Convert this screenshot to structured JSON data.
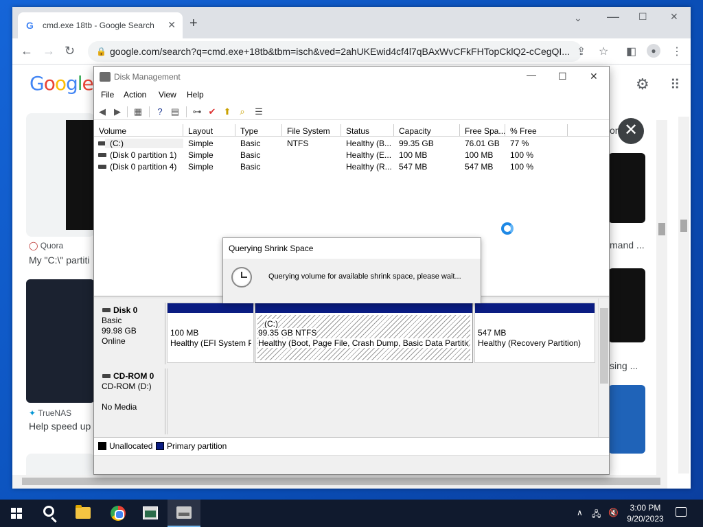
{
  "browser": {
    "tab_title": "cmd.exe 18tb - Google Search",
    "tab_favicon": "G",
    "new_tab": "+",
    "url": "google.com/search?q=cmd.exe+18tb&tbm=isch&ved=2ahUKEwid4cf4l7qBAxWvCFkFHTopCklQ2-cCegQI..."
  },
  "google": {
    "results": [
      {
        "source": "Quora",
        "title": "My \"C:\\\" partiti"
      },
      {
        "source": "TrueNAS",
        "title": "Help speed up"
      }
    ],
    "right_snippets": [
      "on th",
      "mand ...",
      "sing ..."
    ]
  },
  "disk_management": {
    "title": "Disk Management",
    "menu": [
      "File",
      "Action",
      "View",
      "Help"
    ],
    "columns": [
      "Volume",
      "Layout",
      "Type",
      "File System",
      "Status",
      "Capacity",
      "Free Spa...",
      "% Free"
    ],
    "volumes": [
      {
        "volume": "(C:)",
        "layout": "Simple",
        "type": "Basic",
        "fs": "NTFS",
        "status": "Healthy (B...",
        "capacity": "99.35 GB",
        "free": "76.01 GB",
        "pct": "77 %"
      },
      {
        "volume": "(Disk 0 partition 1)",
        "layout": "Simple",
        "type": "Basic",
        "fs": "",
        "status": "Healthy (E...",
        "capacity": "100 MB",
        "free": "100 MB",
        "pct": "100 %"
      },
      {
        "volume": "(Disk 0 partition 4)",
        "layout": "Simple",
        "type": "Basic",
        "fs": "",
        "status": "Healthy (R...",
        "capacity": "547 MB",
        "free": "547 MB",
        "pct": "100 %"
      }
    ],
    "disks": [
      {
        "name": "Disk 0",
        "lines": [
          "Basic",
          "99.98 GB",
          "Online"
        ]
      },
      {
        "name": "CD-ROM 0",
        "lines": [
          "CD-ROM (D:)",
          "",
          "No Media"
        ]
      }
    ],
    "partitions": [
      {
        "size": "100 MB",
        "status": "Healthy (EFI System P"
      },
      {
        "label": "(C:)",
        "size": "99.35 GB NTFS",
        "status": "Healthy (Boot, Page File, Crash Dump, Basic Data Partition"
      },
      {
        "size": "547 MB",
        "status": "Healthy (Recovery Partition)"
      }
    ],
    "legend": [
      {
        "label": "Unallocated",
        "color": "#000000"
      },
      {
        "label": "Primary partition",
        "color": "#0a1c82"
      }
    ]
  },
  "dialog": {
    "title": "Querying Shrink Space",
    "message": "Querying volume for available shrink space, please wait..."
  },
  "taskbar": {
    "time": "3:00 PM",
    "date": "9/20/2023"
  }
}
